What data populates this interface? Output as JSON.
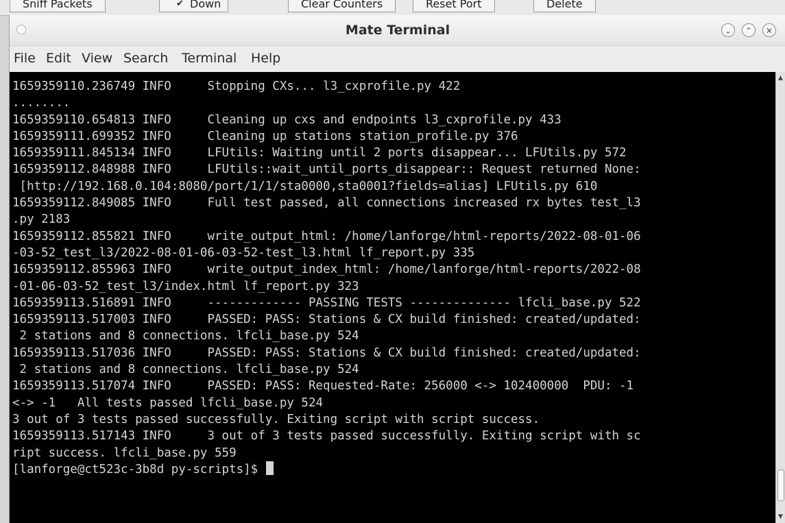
{
  "background_app": {
    "buttons": [
      "Sniff Packets",
      "Down",
      "Clear Counters",
      "Reset Port",
      "Delete"
    ],
    "checkbox_mark": "✔"
  },
  "window": {
    "title": "Mate Terminal",
    "controls": {
      "minimize": "⌄",
      "maximize": "⌃",
      "close": "✕"
    }
  },
  "menu": [
    "File",
    "Edit",
    "View",
    "Search",
    "Terminal",
    "Help"
  ],
  "terminal": {
    "lines": [
      "1659359110.236749 INFO     Stopping CXs... l3_cxprofile.py 422",
      "........",
      "1659359110.654813 INFO     Cleaning up cxs and endpoints l3_cxprofile.py 433",
      "1659359111.699352 INFO     Cleaning up stations station_profile.py 376",
      "1659359111.845134 INFO     LFUtils: Waiting until 2 ports disappear... LFUtils.py 572",
      "1659359112.848988 INFO     LFUtils::wait_until_ports_disappear:: Request returned None:",
      " [http://192.168.0.104:8080/port/1/1/sta0000,sta0001?fields=alias] LFUtils.py 610",
      "1659359112.849085 INFO     Full test passed, all connections increased rx bytes test_l3",
      ".py 2183",
      "1659359112.855821 INFO     write_output_html: /home/lanforge/html-reports/2022-08-01-06",
      "-03-52_test_l3/2022-08-01-06-03-52-test_l3.html lf_report.py 335",
      "1659359112.855963 INFO     write_output_index_html: /home/lanforge/html-reports/2022-08",
      "-01-06-03-52_test_l3/index.html lf_report.py 323",
      "1659359113.516891 INFO     ------------- PASSING TESTS -------------- lfcli_base.py 522",
      "1659359113.517003 INFO     PASSED: PASS: Stations & CX build finished: created/updated:",
      " 2 stations and 8 connections. lfcli_base.py 524",
      "1659359113.517036 INFO     PASSED: PASS: Stations & CX build finished: created/updated:",
      " 2 stations and 8 connections. lfcli_base.py 524",
      "1659359113.517074 INFO     PASSED: PASS: Requested-Rate: 256000 <-> 102400000  PDU: -1",
      "<-> -1   All tests passed lfcli_base.py 524",
      "3 out of 3 tests passed successfully. Exiting script with script success.",
      "1659359113.517143 INFO     3 out of 3 tests passed successfully. Exiting script with sc",
      "ript success. lfcli_base.py 559"
    ],
    "prompt": "[lanforge@ct523c-3b8d py-scripts]$ "
  },
  "colors": {
    "terminal_bg": "#000000",
    "terminal_fg": "#d3d7cf",
    "window_chrome": "#ececec"
  }
}
